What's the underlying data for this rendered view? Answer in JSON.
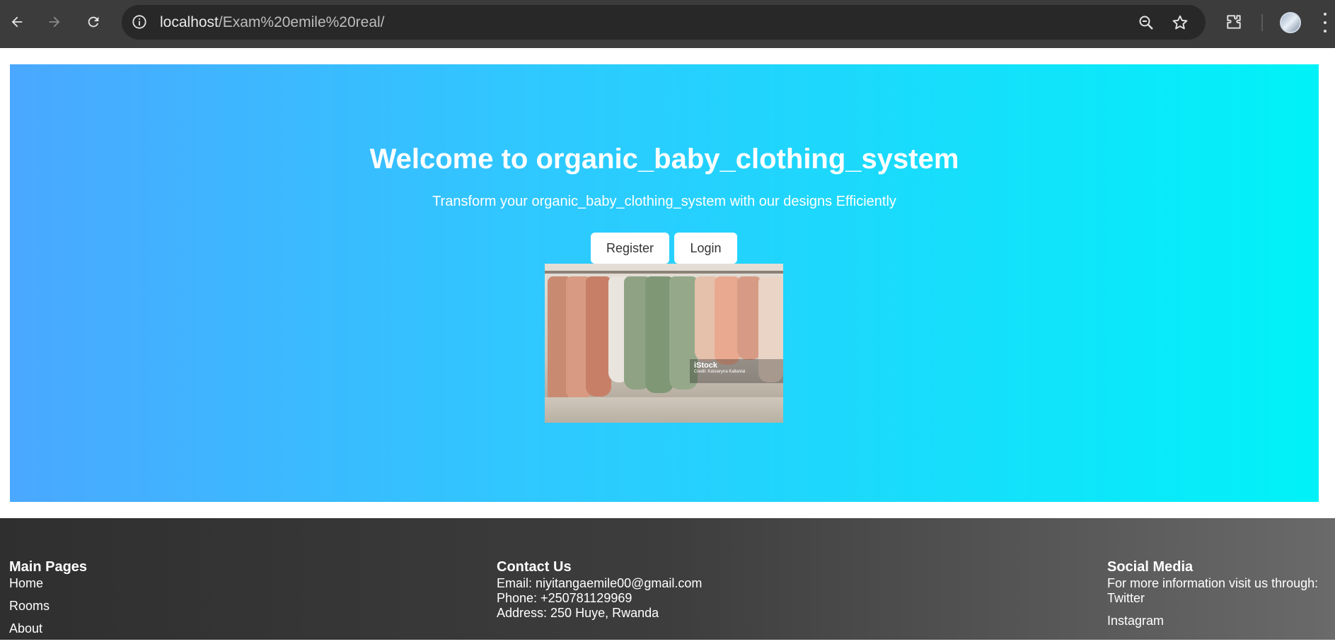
{
  "browser": {
    "url_host": "localhost",
    "url_path": "/Exam%20emile%20real/"
  },
  "hero": {
    "title": "Welcome to organic_baby_clothing_system",
    "subtitle": "Transform your organic_baby_clothing_system with our designs Efficiently",
    "register_label": "Register",
    "login_label": "Login",
    "image": {
      "watermark_brand": "iStock",
      "watermark_credit": "Credit: Katsiaryna Kallantai"
    },
    "gradient": [
      "#4aa8ff",
      "#00f2f8"
    ]
  },
  "footer": {
    "main_pages": {
      "title": "Main Pages",
      "links": [
        "Home",
        "Rooms",
        "About"
      ]
    },
    "contact": {
      "title": "Contact Us",
      "email": "Email: niyitangaemile00@gmail.com",
      "phone": "Phone: +250781129969",
      "address": "Address: 250 Huye, Rwanda"
    },
    "social": {
      "title": "Social Media",
      "intro": "For more information visit us through:",
      "links": [
        "Twitter",
        "Instagram"
      ]
    }
  },
  "icons": [
    "back-icon",
    "forward-icon",
    "reload-icon",
    "info-icon",
    "zoom-icon",
    "star-icon",
    "extensions-icon",
    "profile-avatar",
    "menu-icon"
  ]
}
